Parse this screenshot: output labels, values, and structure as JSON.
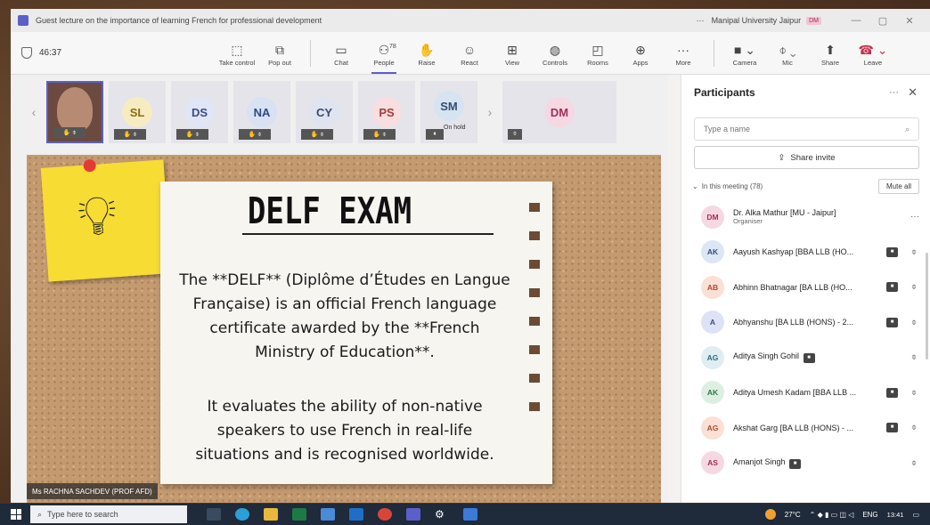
{
  "titlebar": {
    "title": "Guest lecture on the importance of learning French for professional development",
    "more": "···",
    "org": "Manipal University Jaipur",
    "org_badge": "DM",
    "minimize": "—",
    "maximize": "▢",
    "close": "✕"
  },
  "toolbar": {
    "timer": "46:37",
    "take_control": "Take control",
    "pop_out": "Pop out",
    "chat": "Chat",
    "people": "People",
    "people_count": "78",
    "raise": "Raise",
    "react": "React",
    "view": "View",
    "controls": "Controls",
    "rooms": "Rooms",
    "apps": "Apps",
    "more": "More",
    "camera": "Camera",
    "mic": "Mic",
    "share": "Share",
    "leave": "Leave"
  },
  "strip": {
    "tiles": [
      {
        "initials": "SL",
        "bg": "#f7ecc1",
        "fg": "#8a6d10"
      },
      {
        "initials": "DS",
        "bg": "#e0e6f6",
        "fg": "#3b4c8a"
      },
      {
        "initials": "NA",
        "bg": "#d8e2f3",
        "fg": "#2d4a80"
      },
      {
        "initials": "CY",
        "bg": "#dfe4f0",
        "fg": "#3a4a70"
      },
      {
        "initials": "PS",
        "bg": "#f8dede",
        "fg": "#a53b3b"
      },
      {
        "initials": "SM",
        "bg": "#d6e4f1",
        "fg": "#2f4f75"
      }
    ],
    "on_hold": "On hold",
    "featured": {
      "initials": "DM",
      "bg": "#f6d8e2",
      "fg": "#a0305a"
    }
  },
  "slide": {
    "title": "DELF EXAM",
    "paragraph1": "The **DELF** (Diplôme d’Études en Langue Française) is an official French language certificate awarded by the **French Ministry of Education**.",
    "paragraph2": "It evaluates the ability of non-native speakers to use French in real-life situations and is recognised worldwide.",
    "speaker": "Ms RACHNA SACHDEV (PROF AFD)"
  },
  "panel": {
    "title": "Participants",
    "search_placeholder": "Type a name",
    "share_invite": "Share invite",
    "in_meeting": "In this meeting (78)",
    "mute_all": "Mute all",
    "participants": [
      {
        "initials": "DM",
        "name": "Dr. Alka Mathur [MU - Jaipur]",
        "role": "Organiser",
        "bg": "#f6d8e2",
        "fg": "#a0305a"
      },
      {
        "initials": "AK",
        "name": "Aayush Kashyap [BBA LLB (HO...",
        "role": "",
        "bg": "#dde6f5",
        "fg": "#2f4f75"
      },
      {
        "initials": "AB",
        "name": "Abhinn Bhatnagar [BA LLB (HO...",
        "role": "",
        "bg": "#fbe0d6",
        "fg": "#b0492a"
      },
      {
        "initials": "A",
        "name": "Abhyanshu [BA LLB (HONS) - 2...",
        "role": "",
        "bg": "#dde3f5",
        "fg": "#3b4c8a"
      },
      {
        "initials": "AG",
        "name": "Aditya Singh Gohil",
        "role": "",
        "bg": "#e0edf3",
        "fg": "#2b6a80"
      },
      {
        "initials": "AK",
        "name": "Aditya Umesh Kadam [BBA LLB ...",
        "role": "",
        "bg": "#ddefe3",
        "fg": "#2d7a4a"
      },
      {
        "initials": "AG",
        "name": "Akshat Garg [BA LLB (HONS) - ...",
        "role": "",
        "bg": "#fbe0d6",
        "fg": "#b0492a"
      },
      {
        "initials": "AS",
        "name": "Amanjot Singh",
        "role": "",
        "bg": "#f6d8e2",
        "fg": "#a0305a"
      }
    ]
  },
  "taskbar": {
    "search": "Type here to search",
    "temp": "27°C",
    "lang": "ENG",
    "time": "13:41"
  }
}
